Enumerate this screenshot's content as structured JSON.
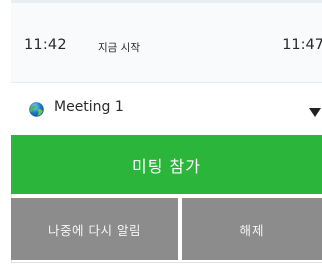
{
  "header": {
    "start_time": "11:42",
    "start_now_label": "지금 시작",
    "end_time": "11:47"
  },
  "meeting": {
    "title": "Meeting 1",
    "icon": "globe-icon",
    "dropdown_icon": "caret-down-icon"
  },
  "actions": {
    "join_label": "미팅 참가",
    "remind_later_label": "나중에 다시 알림",
    "dismiss_label": "해제"
  },
  "colors": {
    "join": "#2bb53b",
    "secondary": "#8c8c8c"
  }
}
